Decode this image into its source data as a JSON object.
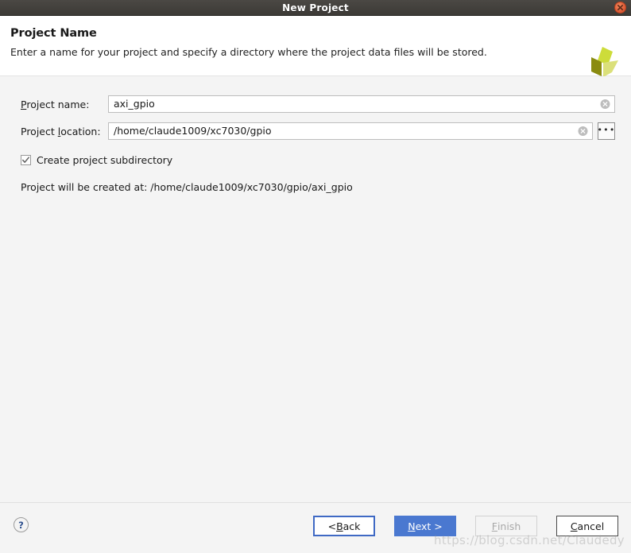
{
  "window": {
    "title": "New Project",
    "close_icon": "close-icon"
  },
  "header": {
    "title": "Project Name",
    "subtitle": "Enter a name for your project and specify a directory where the project data files will be stored.",
    "logo_icon": "xilinx-logo-icon"
  },
  "form": {
    "project_name": {
      "label_pre": "",
      "label_accel": "P",
      "label_post": "roject name:",
      "value": "axi_gpio",
      "placeholder": "",
      "clear_icon": "clear-icon"
    },
    "project_location": {
      "label_pre": "Project ",
      "label_accel": "l",
      "label_post": "ocation:",
      "value": "/home/claude1009/xc7030/gpio",
      "placeholder": "",
      "clear_icon": "clear-icon",
      "browse_label": "•••"
    },
    "create_subdirectory": {
      "label": "Create project subdirectory",
      "checked": true,
      "check_icon": "checkmark-icon"
    },
    "created_at": "Project will be created at: /home/claude1009/xc7030/gpio/axi_gpio"
  },
  "footer": {
    "help_label": "?",
    "buttons": [
      {
        "name": "back",
        "pre": "< ",
        "accel": "B",
        "post": "ack"
      },
      {
        "name": "next",
        "pre": "",
        "accel": "N",
        "post": "ext >"
      },
      {
        "name": "finish",
        "pre": "",
        "accel": "F",
        "post": "inish"
      },
      {
        "name": "cancel",
        "pre": "",
        "accel": "C",
        "post": "ancel"
      }
    ]
  },
  "watermark": {
    "text": "https://blog.csdn.net/Claudedy"
  },
  "colors": {
    "titlebar": "#3c3a36",
    "accent_blue": "#4a78d0",
    "close_red": "#e0603a",
    "logo_bright": "#cddc3a",
    "logo_dark": "#8a8b10",
    "logo_pale": "#dbe07a"
  }
}
